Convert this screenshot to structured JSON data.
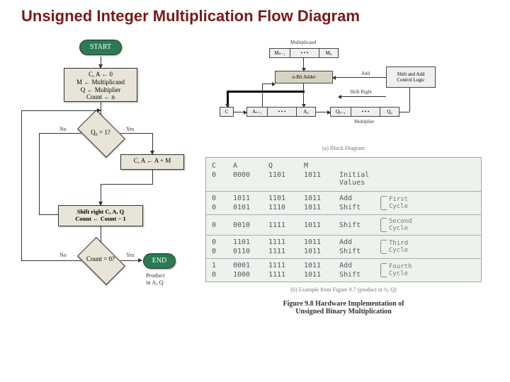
{
  "title": "Unsigned Integer Multiplication Flow Diagram",
  "flowchart": {
    "start": "START",
    "init": "C, A ← 0\nM ← Multiplicand\nQ ← Multiplier\nCount ← n",
    "q0_test": "Q₀ = 1?",
    "no": "No",
    "yes": "Yes",
    "add": "C, A ← A + M",
    "shift": "Shift right C, A, Q\nCount ← Count − 1",
    "count_test": "Count = 0?",
    "end": "END",
    "product": "Product\nin A, Q"
  },
  "block": {
    "multiplicand": "Multiplicand",
    "m_hi": "Mₙ₋₁",
    "dots": "• • •",
    "m_lo": "M₀",
    "adder": "n-Bit Adder",
    "add_label": "Add",
    "control": "Shift and Add\nControl Logic",
    "shift_right": "Shift Right",
    "c": "C",
    "a_hi": "Aₙ₋₁",
    "a_lo": "A₀",
    "q_hi": "Qₙ₋₁",
    "q_lo": "Q₀",
    "multiplier": "Multiplier",
    "caption_a": "(a) Block Diagram"
  },
  "trace": {
    "headers": {
      "C": "C",
      "A": "A",
      "Q": "Q",
      "M": "M",
      "op": "",
      "cycle": ""
    },
    "initial": {
      "C": "0",
      "A": "0000",
      "Q": "1101",
      "M": "1011",
      "op": "Initial Values"
    },
    "cycles": [
      {
        "label": "First\nCycle",
        "rows": [
          {
            "C": "0",
            "A": "1011",
            "Q": "1101",
            "M": "1011",
            "op": "Add"
          },
          {
            "C": "0",
            "A": "0101",
            "Q": "1110",
            "M": "1011",
            "op": "Shift"
          }
        ]
      },
      {
        "label": "Second\nCycle",
        "rows": [
          {
            "C": "0",
            "A": "0010",
            "Q": "1111",
            "M": "1011",
            "op": "Shift"
          }
        ]
      },
      {
        "label": "Third\nCycle",
        "rows": [
          {
            "C": "0",
            "A": "1101",
            "Q": "1111",
            "M": "1011",
            "op": "Add"
          },
          {
            "C": "0",
            "A": "0110",
            "Q": "1111",
            "M": "1011",
            "op": "Shift"
          }
        ]
      },
      {
        "label": "Fourth\nCycle",
        "rows": [
          {
            "C": "1",
            "A": "0001",
            "Q": "1111",
            "M": "1011",
            "op": "Add"
          },
          {
            "C": "0",
            "A": "1000",
            "Q": "1111",
            "M": "1011",
            "op": "Shift"
          }
        ]
      }
    ],
    "caption_b": "(b) Example from Figure 9.7 (product in A, Q)"
  },
  "figure_caption": "Figure 9.8  Hardware Implementation of\nUnsigned Binary Multiplication"
}
